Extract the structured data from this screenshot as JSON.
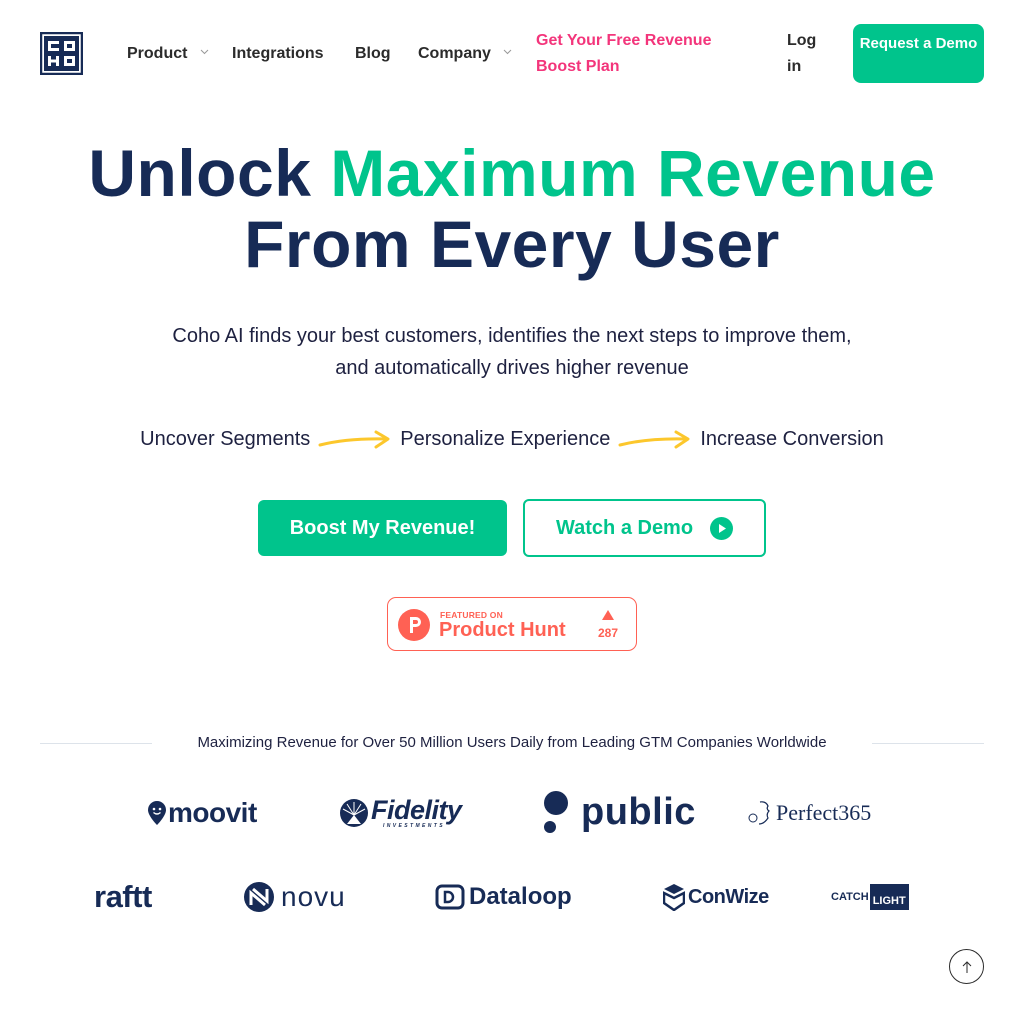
{
  "colors": {
    "brand_navy": "#172b56",
    "accent_green": "#00c48c",
    "promo_pink": "#f3357b",
    "arrow_yellow": "#fcc72c",
    "product_hunt": "#ff6154"
  },
  "nav": {
    "logo_alt": "COHO",
    "items": [
      {
        "label": "Product",
        "has_dropdown": true
      },
      {
        "label": "Integrations",
        "has_dropdown": false
      },
      {
        "label": "Blog",
        "has_dropdown": false
      },
      {
        "label": "Company",
        "has_dropdown": true
      }
    ],
    "promo_link": "Get Your Free Revenue Boost Plan",
    "login": "Log in",
    "request_demo": "Request a Demo"
  },
  "hero": {
    "title_part1": "Unlock ",
    "title_accent": "Maximum Revenue",
    "title_line2": "From Every User",
    "subtitle_line1": "Coho AI finds your best customers, identifies the next steps to improve them,",
    "subtitle_line2": "and automatically drives higher revenue",
    "steps": [
      "Uncover Segments",
      "Personalize Experience",
      "Increase Conversion"
    ],
    "primary_cta": "Boost My Revenue!",
    "secondary_cta": "Watch a Demo"
  },
  "product_hunt": {
    "featured_label": "FEATURED ON",
    "name": "Product Hunt",
    "upvotes": "287"
  },
  "trust": {
    "heading": "Maximizing Revenue for Over 50 Million Users Daily from Leading GTM Companies Worldwide",
    "logos_row1": [
      "moovit",
      "Fidelity",
      "public",
      "Perfect365"
    ],
    "logos_row2": [
      "raftt",
      "novu",
      "Dataloop",
      "ConWize",
      "CATCHLIGHT"
    ],
    "fidelity_sub": "INVESTMENTS",
    "catch": "CATCH",
    "light": "LIGHT"
  }
}
